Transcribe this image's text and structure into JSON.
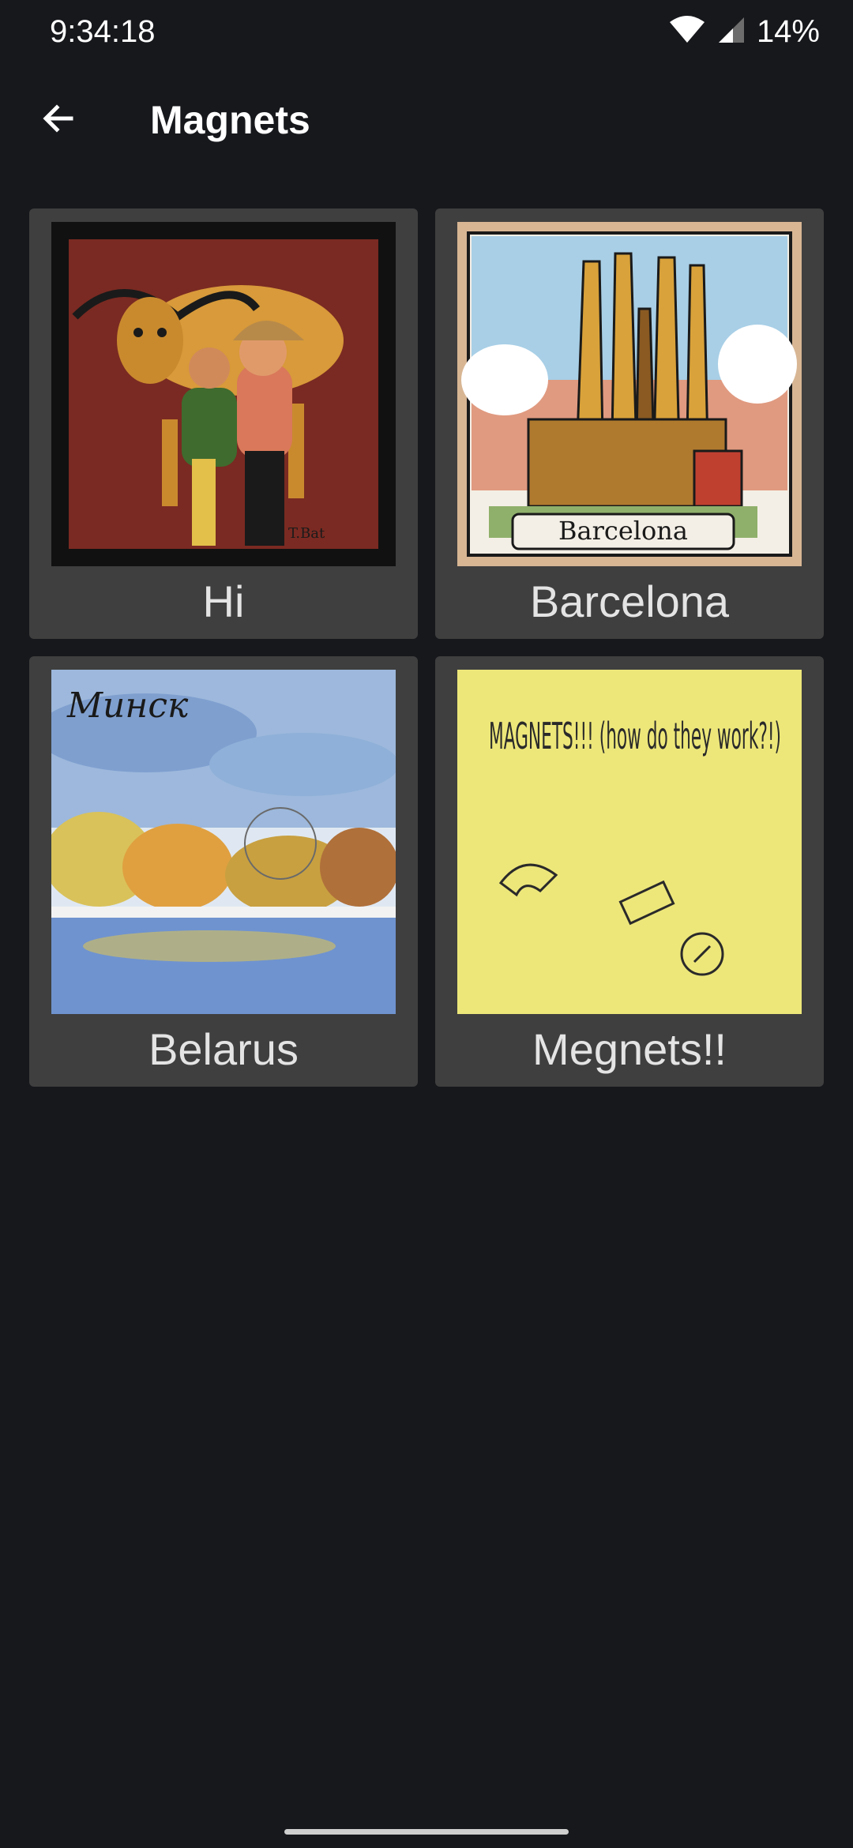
{
  "status_bar": {
    "time": "9:34:18",
    "battery": "14%",
    "icons": [
      "wifi-icon",
      "signal-icon"
    ]
  },
  "app_bar": {
    "title": "Magnets",
    "back_icon": "arrow-left-icon"
  },
  "magnets": [
    {
      "label": "Hi",
      "image": "bull-and-children-tile"
    },
    {
      "label": "Barcelona",
      "image": "sagrada-familia-tile",
      "image_text": "Barcelona"
    },
    {
      "label": "Belarus",
      "image": "minsk-watercolor-tile",
      "image_text": "Минск"
    },
    {
      "label": "Megnets!!",
      "image": "sticky-note-drawing",
      "image_text": "MAGNETS!!! (how do they work?!)"
    }
  ],
  "colors": {
    "background": "#17181c",
    "card": "#3f3f3f",
    "label": "#e4e4e4"
  }
}
